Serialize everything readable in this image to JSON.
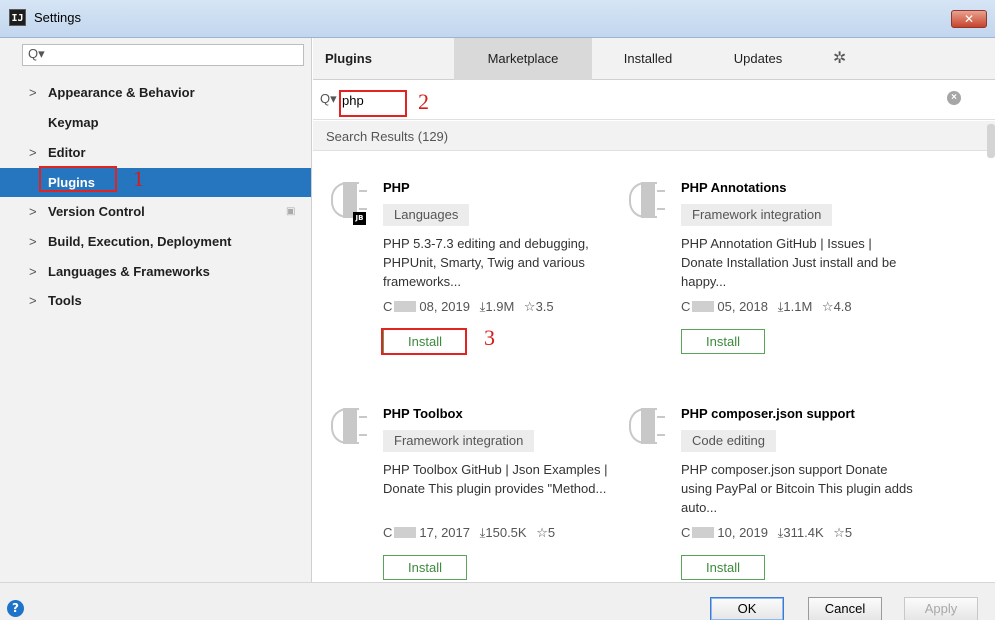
{
  "window": {
    "title": "Settings",
    "icon_text": "IJ",
    "close_glyph": "✕"
  },
  "sidebar": {
    "search_glyph": "Q▾",
    "items": [
      {
        "label": "Appearance & Behavior",
        "chevron": ">"
      },
      {
        "label": "Keymap",
        "chevron": ""
      },
      {
        "label": "Editor",
        "chevron": ">"
      },
      {
        "label": "Plugins",
        "chevron": ""
      },
      {
        "label": "Version Control",
        "chevron": ">"
      },
      {
        "label": "Build, Execution, Deployment",
        "chevron": ">"
      },
      {
        "label": "Languages & Frameworks",
        "chevron": ">"
      },
      {
        "label": "Tools",
        "chevron": ">"
      }
    ],
    "selected": "Plugins"
  },
  "main": {
    "title": "Plugins",
    "tabs": [
      {
        "label": "Marketplace",
        "active": true
      },
      {
        "label": "Installed",
        "active": false
      },
      {
        "label": "Updates",
        "active": false
      }
    ],
    "gear_glyph": "✲",
    "search": {
      "glyph": "Q▾",
      "value": "php",
      "clear_glyph": "×"
    },
    "results_label": "Search Results (129)",
    "plugins": [
      {
        "name": "PHP",
        "category": "Languages",
        "jb_badge": "JB",
        "description": "PHP 5.3-7.3 editing and debugging, PHPUnit, Smarty, Twig and various frameworks...",
        "date": "08, 2019",
        "downloads": "1.9M",
        "rating": "3.5",
        "install_label": "Install"
      },
      {
        "name": "PHP Annotations",
        "category": "Framework integration",
        "jb_badge": "",
        "description": "PHP Annotation GitHub | Issues | Donate Installation Just install and be happy...",
        "date": "05, 2018",
        "downloads": "1.1M",
        "rating": "4.8",
        "install_label": "Install"
      },
      {
        "name": "PHP Toolbox",
        "category": "Framework integration",
        "jb_badge": "",
        "description": "PHP Toolbox GitHub | Json Examples | Donate This plugin provides \"Method...",
        "date": "17, 2017",
        "downloads": "150.5K",
        "rating": "5",
        "install_label": "Install"
      },
      {
        "name": "PHP composer.json support",
        "category": "Code editing",
        "jb_badge": "",
        "description": "PHP composer.json support Donate using PayPal or Bitcoin This plugin adds auto...",
        "date": "10, 2019",
        "downloads": "311.4K",
        "rating": "5",
        "install_label": "Install"
      }
    ],
    "stat_glyphs": {
      "updated": "C",
      "download": "⤓",
      "star": "☆"
    }
  },
  "annotations": {
    "step1": "1",
    "step2": "2",
    "step3": "3"
  },
  "footer": {
    "help_glyph": "?",
    "ok": "OK",
    "cancel": "Cancel",
    "apply": "Apply"
  }
}
